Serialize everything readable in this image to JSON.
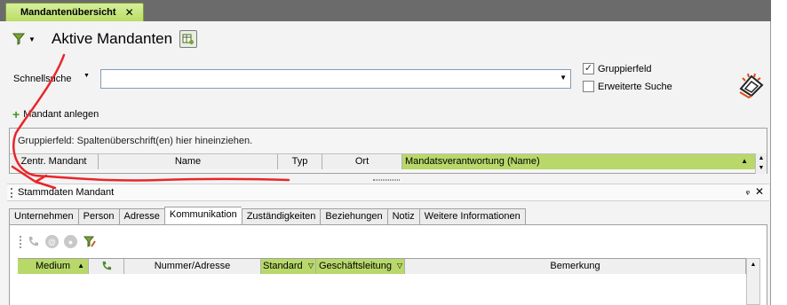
{
  "window_tab": {
    "label": "Mandantenübersicht",
    "close": "✕"
  },
  "header": {
    "title": "Aktive Mandanten"
  },
  "search": {
    "label": "Schnellsuche",
    "value": "",
    "placeholder": ""
  },
  "options": {
    "group_field": "Gruppierfeld",
    "group_field_checked": true,
    "extended_search": "Erweiterte Suche",
    "extended_search_checked": false
  },
  "actions": {
    "add_client": "Mandant anlegen"
  },
  "grid1": {
    "group_hint": "Gruppierfeld: Spaltenüberschrift(en) hier hineinziehen.",
    "columns": [
      "Zentr. Mandant",
      "Name",
      "Typ",
      "Ort",
      "Mandatsverantwortung (Name)"
    ]
  },
  "panel": {
    "title": "Stammdaten Mandant",
    "pin": "ᵩ",
    "close": "✕"
  },
  "tabs": [
    "Unternehmen",
    "Person",
    "Adresse",
    "Kommunikation",
    "Zuständigkeiten",
    "Beziehungen",
    "Notiz",
    "Weitere Informationen"
  ],
  "active_tab_index": 3,
  "grid2": {
    "columns": [
      "Medium",
      "",
      "Nummer/Adresse",
      "Standard",
      "Geschäftsleitung",
      "Bemerkung"
    ]
  },
  "colors": {
    "accent_green": "#b8d86a",
    "tab_green": "#c7e57f",
    "annotation_red": "#e8262a"
  },
  "icons": [
    "filter-icon",
    "grid-settings-icon",
    "logo-icon",
    "plus-icon",
    "phone-icon",
    "at-icon",
    "circle-icon",
    "filter-edit-icon"
  ]
}
